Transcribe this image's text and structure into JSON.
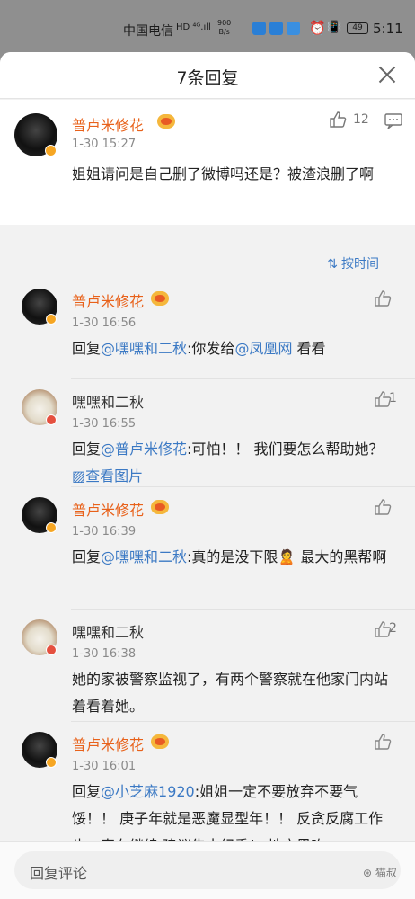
{
  "status_bar": {
    "carrier": "中国电信",
    "signal": "HD ⁴ᴳ.ıll",
    "net_speed": "900\nB/s",
    "battery": "49",
    "time": "5:11"
  },
  "sheet": {
    "title": "7条回复",
    "close_icon": "close-icon"
  },
  "main_comment": {
    "name": "普卢米修花",
    "time": "1-30 15:27",
    "likes": "12",
    "text": "姐姐请问是自己删了微博吗还是？被渣浪删了啊"
  },
  "sort": {
    "label": "按时间",
    "icon": "sort-icon"
  },
  "replies": [
    {
      "name": "普卢米修花",
      "verified_color": "#f6a623",
      "avatar": "dark",
      "vip": true,
      "time": "1-30 16:56",
      "likes": "",
      "prefix": "回复",
      "mention": "@嘿嘿和二秋",
      "text": ":你发给",
      "mention2": "@凤凰网",
      "text2": " 看看"
    },
    {
      "name": "嘿嘿和二秋",
      "verified_color": "#e5503f",
      "avatar": "dog",
      "vip": false,
      "time": "1-30 16:55",
      "likes": "1",
      "prefix": "回复",
      "mention": "@普卢米修花",
      "text": ":可怕！！ 我们要怎么帮助她？ ",
      "mention2": "▨查看图片",
      "text2": ""
    },
    {
      "name": "普卢米修花",
      "verified_color": "#f6a623",
      "avatar": "dark",
      "vip": true,
      "time": "1-30 16:39",
      "likes": "",
      "prefix": "回复",
      "mention": "@嘿嘿和二秋",
      "text": ":真的是没下限🙎 最大的黑帮啊",
      "mention2": "",
      "text2": ""
    },
    {
      "name": "嘿嘿和二秋",
      "verified_color": "#e5503f",
      "avatar": "dog",
      "vip": false,
      "time": "1-30 16:38",
      "likes": "2",
      "prefix": "",
      "mention": "",
      "text": "她的家被警察监视了，有两个警察就在他家门内站着看着她。",
      "mention2": "",
      "text2": ""
    },
    {
      "name": "普卢米修花",
      "verified_color": "#f6a623",
      "avatar": "dark",
      "vip": true,
      "time": "1-30 16:01",
      "likes": "",
      "prefix": "回复",
      "mention": "@小芝麻1920",
      "text": ":姐姐一定不要放弃不要气馁！！ 庚子年就是恶魔显型年！！ 反贪反腐工作也一直在继续 建议告中纪委！ 地方黑吃",
      "mention2": "",
      "text2": ""
    }
  ],
  "input": {
    "placeholder": "回复评论"
  },
  "watermark": "⊛ 猫叔"
}
